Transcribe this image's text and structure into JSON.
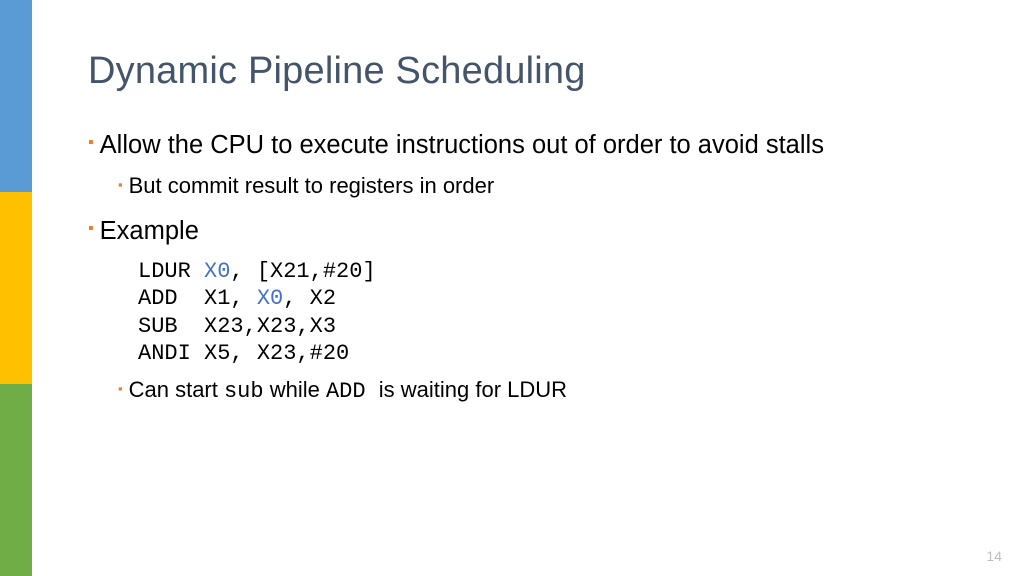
{
  "title": "Dynamic Pipeline Scheduling",
  "bullets": {
    "b1": "Allow the CPU to execute instructions out of order to avoid stalls",
    "b1_1": "But commit result to registers in order",
    "b2": "Example",
    "b2_2_pre": "Can start ",
    "b2_2_sub": "sub",
    "b2_2_mid": " while ",
    "b2_2_add": "ADD ",
    "b2_2_post": " is waiting for LDUR"
  },
  "code": {
    "l1a": "LDUR ",
    "l1b": "X0",
    "l1c": ", [X21,#20]",
    "l2a": "ADD  X1, ",
    "l2b": "X0",
    "l2c": ", X2",
    "l3": "SUB  X23,X23,X3",
    "l4": "ANDI X5, X23,#20"
  },
  "page_number": "14"
}
